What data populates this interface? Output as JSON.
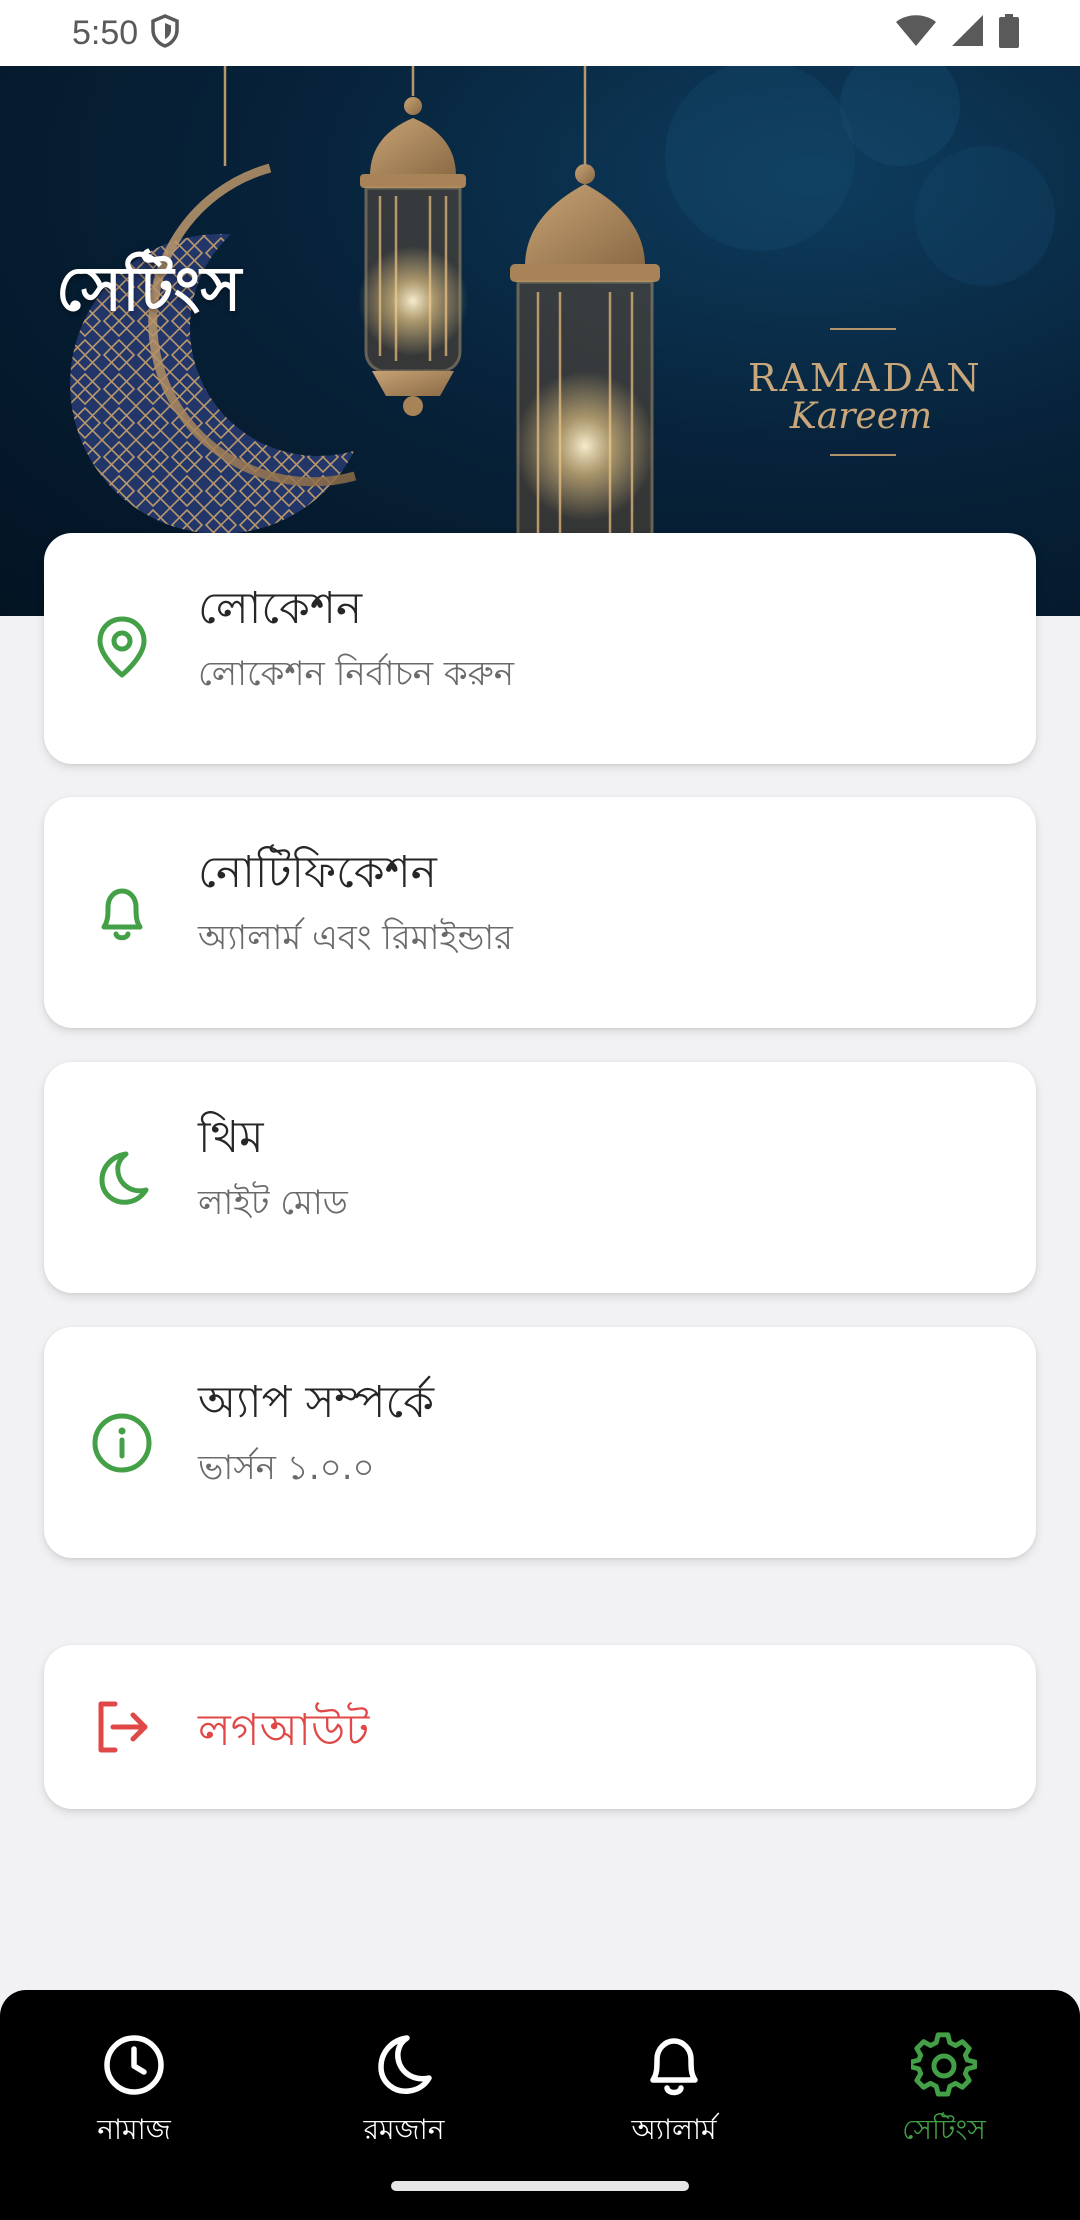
{
  "status_bar": {
    "time": "5:50",
    "icons": [
      "shield-icon",
      "wifi-icon",
      "signal-icon",
      "battery-icon"
    ]
  },
  "header": {
    "title": "সেটিংস",
    "banner_text_line1": "RAMADAN",
    "banner_text_line2": "Kareem"
  },
  "settings": [
    {
      "title": "লোকেশন",
      "subtitle": "লোকেশন নির্বাচন করুন",
      "icon": "location-pin-icon"
    },
    {
      "title": "নোটিফিকেশন",
      "subtitle": "অ্যালার্ম এবং রিমাইন্ডার",
      "icon": "bell-icon"
    },
    {
      "title": "থিম",
      "subtitle": "লাইট মোড",
      "icon": "moon-icon"
    },
    {
      "title": "অ্যাপ সম্পর্কে",
      "subtitle": "ভার্সন ১.০.০",
      "icon": "info-icon"
    }
  ],
  "logout": {
    "label": "লগআউট",
    "icon": "logout-icon"
  },
  "bottom_nav": {
    "items": [
      {
        "label": "নামাজ",
        "icon": "clock-icon"
      },
      {
        "label": "রমজান",
        "icon": "moon-icon"
      },
      {
        "label": "অ্যালার্ম",
        "icon": "bell-icon"
      },
      {
        "label": "সেটিংস",
        "icon": "gear-icon",
        "active": true
      }
    ]
  },
  "colors": {
    "accent_green": "#43a047",
    "logout_red": "#e04848",
    "banner_gold": "#c9a77a",
    "nav_background": "#000000"
  }
}
